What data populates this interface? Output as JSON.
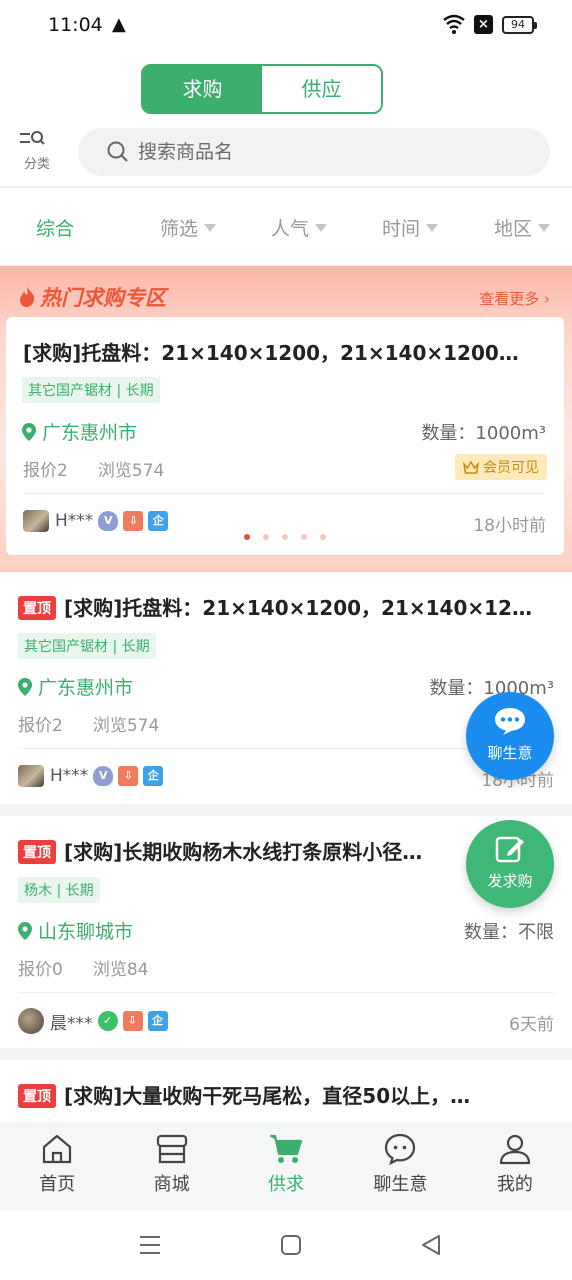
{
  "status": {
    "time": "11:04",
    "battery": "94"
  },
  "header": {
    "seg": [
      "求购",
      "供应"
    ],
    "category_label": "分类",
    "search_placeholder": "搜索商品名"
  },
  "filters": [
    "综合",
    "筛选",
    "人气",
    "时间",
    "地区"
  ],
  "hot": {
    "title": "热门求购专区",
    "more": "查看更多",
    "card": {
      "title": "[求购]托盘料：21×140×1200，21×140×1200…",
      "tag": "其它国产锯材 | 长期",
      "location": "广东惠州市",
      "qty": "数量：1000m³",
      "quote": "报价2",
      "views": "浏览574",
      "member": "会员可见",
      "user": "H***",
      "time": "18小时前"
    }
  },
  "listings": [
    {
      "pin": "置顶",
      "title": "[求购]托盘料：21×140×1200，21×140×12…",
      "tag": "其它国产锯材 | 长期",
      "location": "广东惠州市",
      "qty": "数量：1000m³",
      "quote": "报价2",
      "views": "浏览574",
      "user": "H***",
      "time": "18小时前"
    },
    {
      "pin": "置顶",
      "title": "[求购]长期收购杨木水线打条原料小径…",
      "tag": "杨木 | 长期",
      "location": "山东聊城市",
      "qty": "数量：不限",
      "quote": "报价0",
      "views": "浏览84",
      "user": "晨***",
      "time": "6天前"
    },
    {
      "pin": "置顶",
      "title": "[求购]大量收购干死马尾松，直径50以上，…"
    }
  ],
  "fab": {
    "chat": "聊生意",
    "post": "发求购"
  },
  "tabs": [
    "首页",
    "商城",
    "供求",
    "聊生意",
    "我的"
  ],
  "colors": {
    "accent": "#3cae6e",
    "hot": "#f05637",
    "pin": "#ee3d3d"
  }
}
